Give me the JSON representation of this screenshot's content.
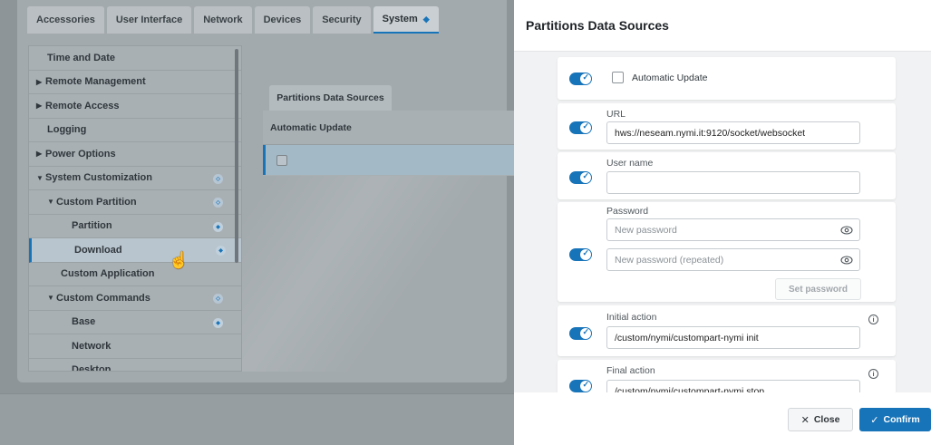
{
  "background": {
    "tabs": [
      {
        "label": "Accessories"
      },
      {
        "label": "User Interface"
      },
      {
        "label": "Network"
      },
      {
        "label": "Devices"
      },
      {
        "label": "Security"
      },
      {
        "label": "System",
        "active": true
      }
    ],
    "nav": [
      {
        "label": "Time and Date",
        "expander": "",
        "level": 0
      },
      {
        "label": "Remote Management",
        "expander": "▶",
        "level": 0
      },
      {
        "label": "Remote Access",
        "expander": "▶",
        "level": 0
      },
      {
        "label": "Logging",
        "expander": "",
        "level": 0
      },
      {
        "label": "Power Options",
        "expander": "▶",
        "level": 0
      },
      {
        "label": "System Customization",
        "expander": "▼",
        "level": 0,
        "mark": "ring"
      },
      {
        "label": "Custom Partition",
        "expander": "▼",
        "level": 1,
        "mark": "ring"
      },
      {
        "label": "Partition",
        "expander": "",
        "level": 2,
        "mark": "solid"
      },
      {
        "label": "Download",
        "expander": "",
        "level": 2,
        "mark": "solid",
        "selected": true
      },
      {
        "label": "Custom Application",
        "expander": "",
        "level": 1
      },
      {
        "label": "Custom Commands",
        "expander": "▼",
        "level": 1,
        "mark": "ring"
      },
      {
        "label": "Base",
        "expander": "",
        "level": 2,
        "mark": "solid"
      },
      {
        "label": "Network",
        "expander": "",
        "level": 2
      },
      {
        "label": "Desktop",
        "expander": "",
        "level": 2
      }
    ],
    "data_sources_tab": "Partitions Data Sources",
    "table_header": "Automatic Update"
  },
  "modal": {
    "title": "Partitions Data Sources",
    "automatic_update": {
      "label": "Automatic Update",
      "checked": false
    },
    "url": {
      "label": "URL",
      "value": "hws://neseam.nymi.it:9120/socket/websocket"
    },
    "user_name": {
      "label": "User name",
      "value": ""
    },
    "password": {
      "label": "Password",
      "placeholder": "New password",
      "placeholder_repeated": "New password (repeated)",
      "set_label": "Set password"
    },
    "initial_action": {
      "label": "Initial action",
      "value": "/custom/nymi/custompart-nymi init"
    },
    "final_action": {
      "label": "Final action",
      "value": "/custom/nymi/custompart-nymi stop"
    },
    "info_glyph": "i",
    "close_label": "Close",
    "confirm_label": "Confirm",
    "accent_color": "#1874b9"
  }
}
